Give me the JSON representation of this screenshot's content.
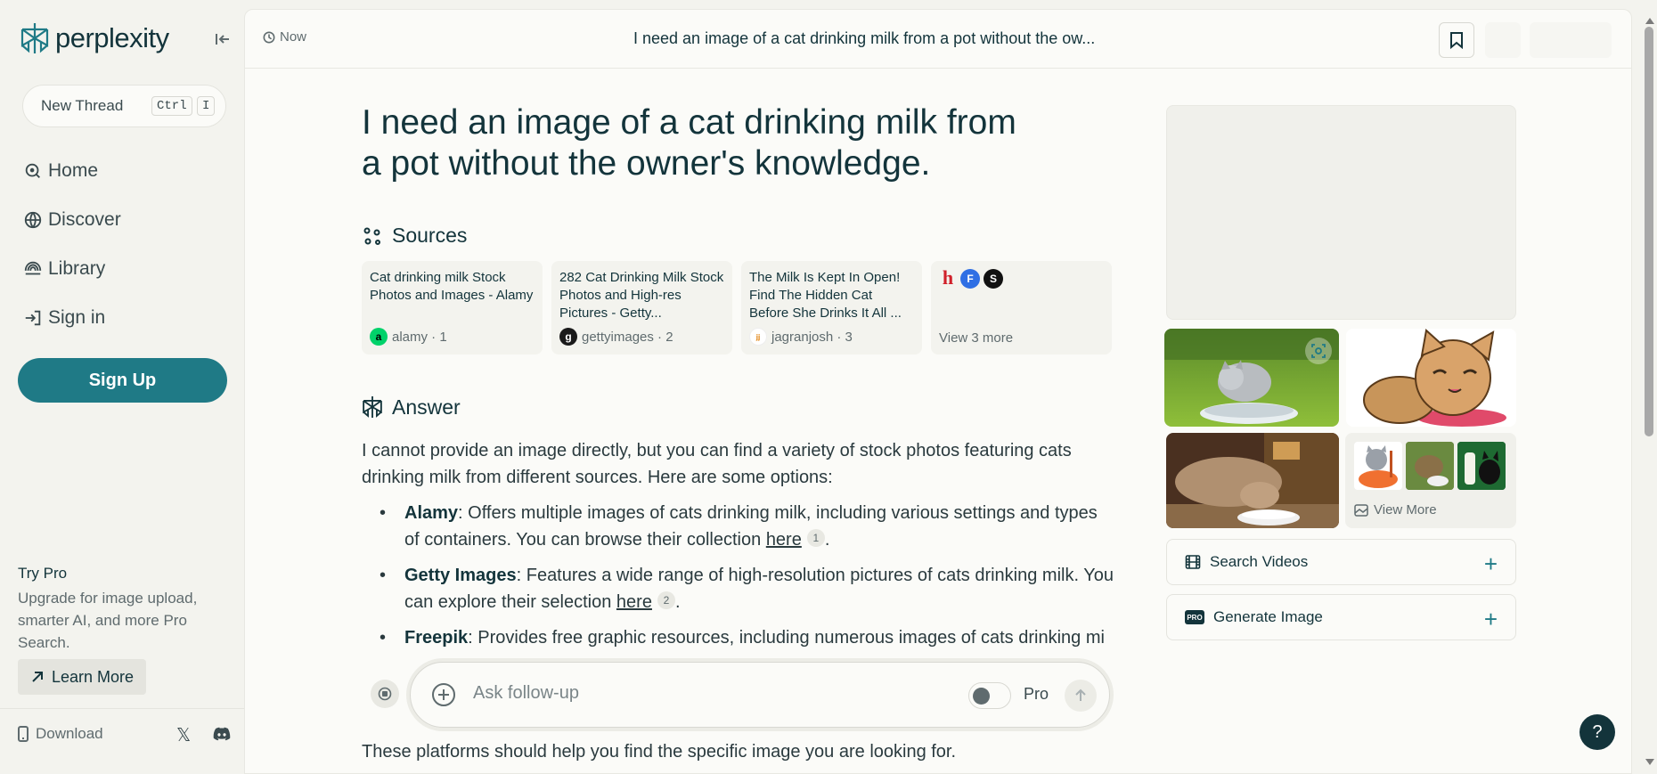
{
  "sidebar": {
    "logo_text": "perplexity",
    "new_thread": {
      "label": "New Thread",
      "key1": "Ctrl",
      "key2": "I"
    },
    "nav": [
      {
        "label": "Home",
        "icon": "search-icon"
      },
      {
        "label": "Discover",
        "icon": "globe-icon"
      },
      {
        "label": "Library",
        "icon": "library-icon"
      },
      {
        "label": "Sign in",
        "icon": "sign-in-icon"
      }
    ],
    "sign_up": "Sign Up",
    "try_pro": {
      "title": "Try Pro",
      "description": "Upgrade for image upload, smarter AI, and more Pro Search.",
      "learn_more": "Learn More"
    },
    "download": "Download"
  },
  "topbar": {
    "time": "Now",
    "title": "I need an image of a cat drinking milk from a pot without the ow..."
  },
  "question": "I need an image of a cat drinking milk from a pot without the owner's knowledge.",
  "sources": {
    "heading": "Sources",
    "items": [
      {
        "title": "Cat drinking milk Stock Photos and Images - Alamy",
        "site": "alamy · 1",
        "fav": "a",
        "fav_color": "#00d26a",
        "fav_text_color": "#000000"
      },
      {
        "title": "282 Cat Drinking Milk Stock Photos and High-res Pictures - Getty...",
        "site": "gettyimages · 2",
        "fav": "g",
        "fav_color": "#1a1a1a",
        "fav_text_color": "#ffffff"
      },
      {
        "title": "The Milk Is Kept In Open! Find The Hidden Cat Before She Drinks It All ...",
        "site": "jagranjosh · 3",
        "fav": "jj",
        "fav_color": "#ffffff",
        "fav_text_color": "#e07b00"
      }
    ],
    "view_more": "View 3 more"
  },
  "answer": {
    "heading": "Answer",
    "intro": "I cannot provide an image directly, but you can find a variety of stock photos featuring cats drinking milk from different sources. Here are some options:",
    "bullets": [
      {
        "name": "Alamy",
        "text": ": Offers multiple images of cats drinking milk, including various settings and types of containers. You can browse their collection ",
        "link": "here",
        "cite": "1",
        "end": "."
      },
      {
        "name": "Getty Images",
        "text": ": Features a wide range of high-resolution pictures of cats drinking milk. You can explore their selection ",
        "link": "here",
        "cite": "2",
        "end": "."
      },
      {
        "name": "Freepik",
        "text": ": Provides free graphic resources, including numerous images of cats drinking mi",
        "link": "",
        "cite": "",
        "end": ""
      }
    ],
    "closing": "These platforms should help you find the specific image you are looking for."
  },
  "followup": {
    "placeholder": "Ask follow-up",
    "pro_label": "Pro"
  },
  "media": {
    "view_more": "View More",
    "search_videos": "Search Videos",
    "generate_image": "Generate Image",
    "pro_badge": "PRO"
  },
  "help": "?"
}
